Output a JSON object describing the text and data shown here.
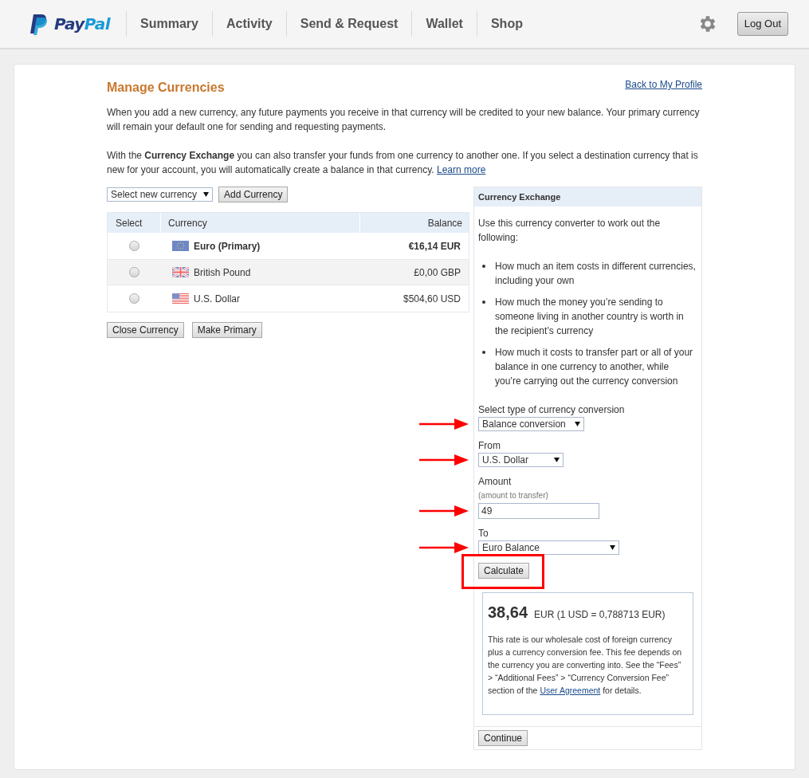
{
  "logo": {
    "part_1": "Pay",
    "part_2": "Pal"
  },
  "nav": {
    "items": [
      {
        "label": "Summary"
      },
      {
        "label": "Activity"
      },
      {
        "label": "Send & Request"
      },
      {
        "label": "Wallet"
      },
      {
        "label": "Shop"
      }
    ],
    "logout": "Log Out"
  },
  "page": {
    "title": "Manage Currencies",
    "back_link": "Back to My Profile",
    "intro": "When you add a new currency, any future payments you receive in that currency will be credited to your new balance. Your primary currency will remain your default one for sending and requesting payments.",
    "exchange_text": "With the **Currency Exchange** you can also transfer your funds from one currency to another one. If you select a destination currency that is new for your account, you will automatically create a balance in that currency.",
    "exchange_link": "Learn more"
  },
  "add": {
    "select": "Select new currency",
    "button": "Add Currency"
  },
  "table": {
    "columns": [
      "Select",
      "Currency",
      "Balance"
    ],
    "rows": [
      {
        "kind": "eu",
        "currency": "Euro (Primary)",
        "balance": "€16,14 EUR",
        "primary": true,
        "selected": false
      },
      {
        "kind": "gb",
        "currency": "British Pound",
        "balance": "£0,00 GBP",
        "primary": false,
        "selected": false
      },
      {
        "kind": "us",
        "currency": "U.S. Dollar",
        "balance": "$504,60 USD",
        "primary": false,
        "selected": false
      }
    ]
  },
  "actions": [
    "Close Currency",
    "Make Primary"
  ],
  "exchange": {
    "title": "Currency Exchange",
    "intro": "Use this currency converter to work out the following:",
    "bullets": [
      "How much an item costs in different currencies, including your own",
      "How much the money you’re sending to someone living in another country is worth in the recipient’s currency",
      "How much it costs to transfer part or all of your balance in one currency to another, while you’re carrying out the currency conversion"
    ],
    "fields": [
      {
        "kind": "select",
        "label": "Select type of currency conversion",
        "value": "Balance conversion"
      },
      {
        "kind": "select",
        "label": "From",
        "value": "U.S. Dollar"
      },
      {
        "kind": "input",
        "label": "Amount",
        "hint": "(amount to transfer)",
        "value": "49"
      },
      {
        "kind": "select",
        "label": "To",
        "value": "Euro Balance"
      }
    ],
    "calculate": "Calculate",
    "result": {
      "amount": "38,64",
      "rate": "EUR (1 USD = 0,788713  EUR)",
      "note": "This rate is our wholesale cost of foreign currency plus a currency conversion fee. This fee depends on the currency you are converting into. See the “Fees” > “Additional Fees” > “Currency Conversion Fee” section of the ",
      "note_link": "User Agreement",
      "note_end": " for details."
    },
    "continue": "Continue"
  }
}
